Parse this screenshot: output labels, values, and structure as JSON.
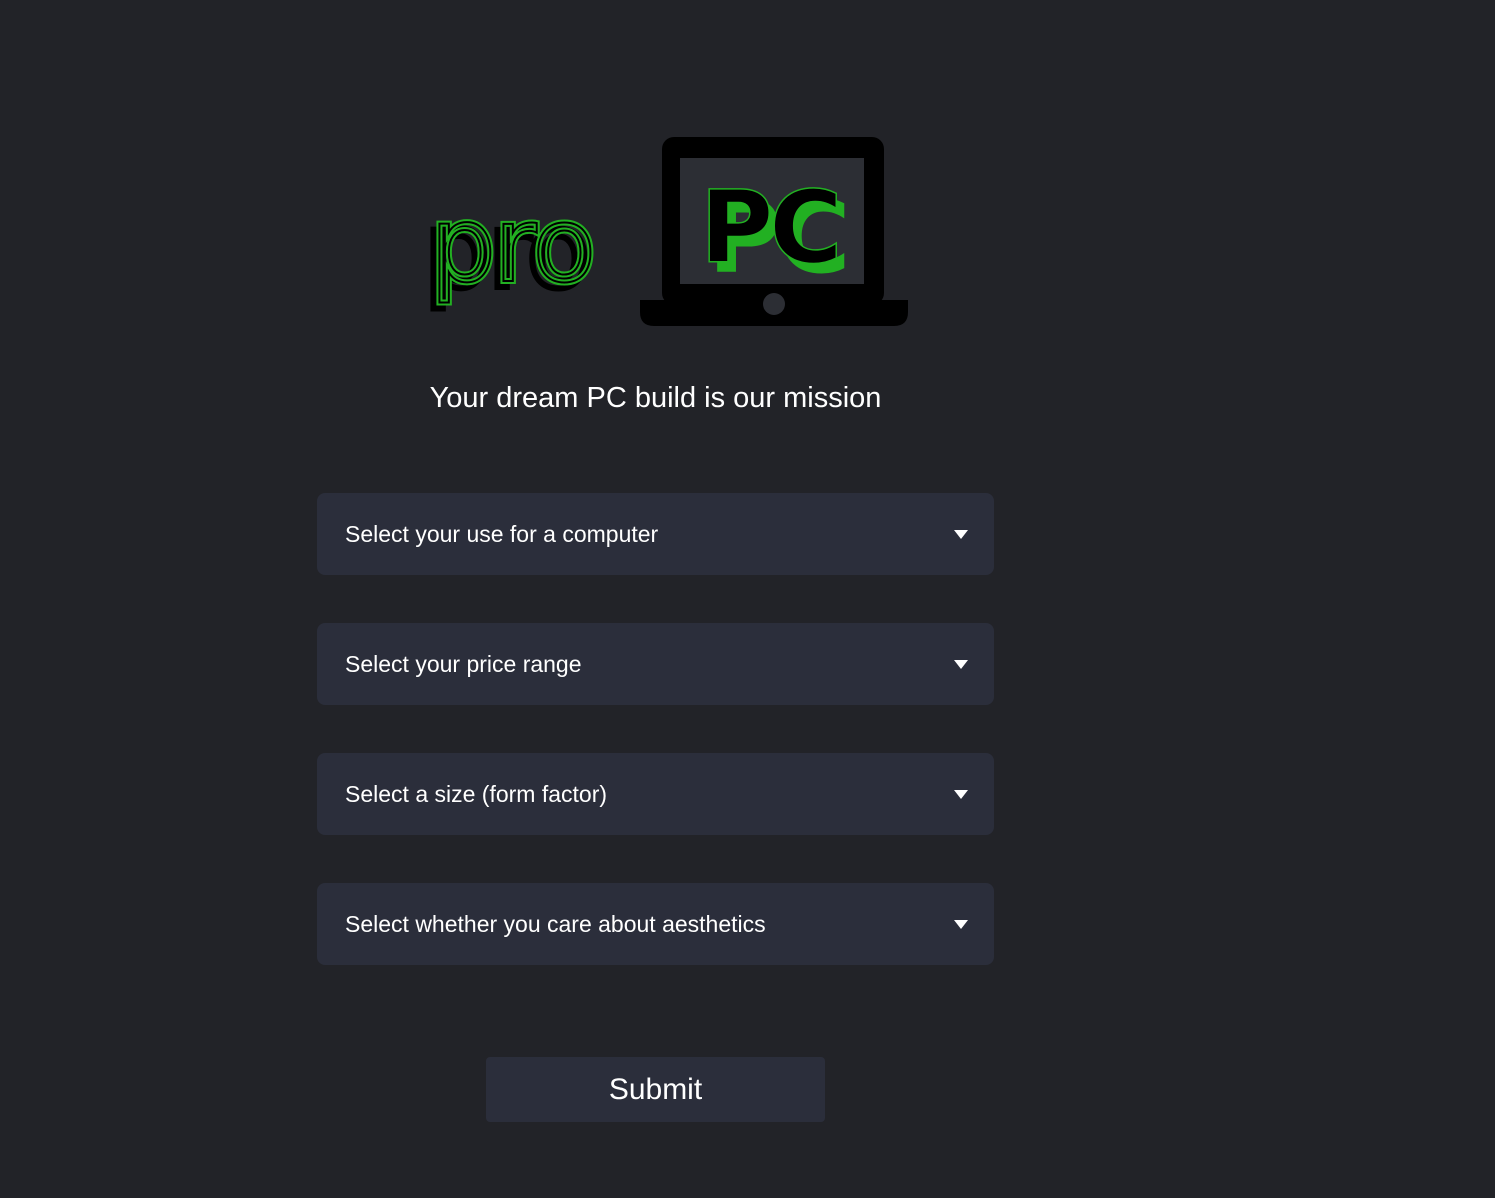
{
  "logo": {
    "text_pro": "pro",
    "text_pc": "PC",
    "accent_color": "#22b022"
  },
  "tagline": "Your dream PC build is our mission",
  "form": {
    "selects": [
      {
        "placeholder": "Select your use for a computer"
      },
      {
        "placeholder": "Select your price range"
      },
      {
        "placeholder": "Select a size (form factor)"
      },
      {
        "placeholder": "Select whether you care about aesthetics"
      }
    ],
    "submit_label": "Submit"
  },
  "colors": {
    "background": "#222328",
    "field": "#2b2e3b",
    "text": "#ffffff"
  }
}
